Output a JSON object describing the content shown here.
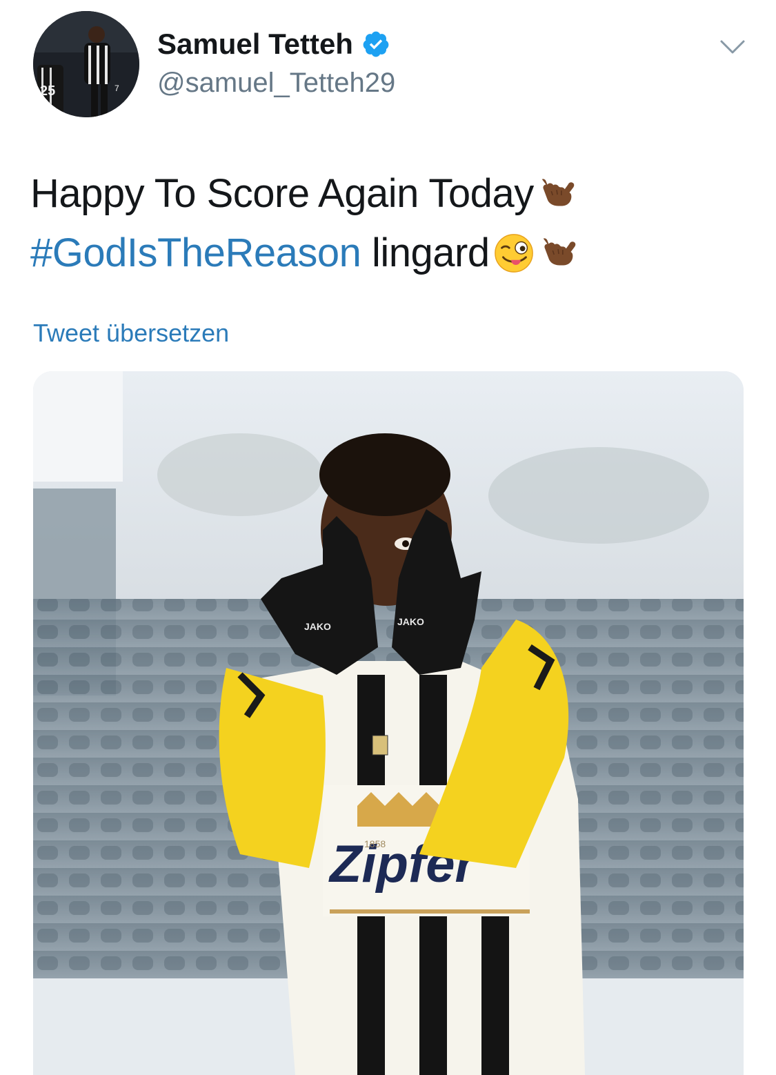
{
  "tweet": {
    "author": {
      "display_name": "Samuel Tetteh",
      "handle": "@samuel_Tetteh29",
      "verified": true,
      "avatar_jersey_numbers": [
        "25",
        "7"
      ]
    },
    "text_line1": "Happy To Score Again Today",
    "hashtag": "#GodIsTheReason",
    "text_line2_rest": " lingard",
    "emojis": [
      "call-me-hand-dark-skin-emoji",
      "winking-face-tongue-emoji"
    ],
    "translate_label": "Tweet übersetzen",
    "media": {
      "glove_brand": "JAKO",
      "sponsor": "Zipfer",
      "sponsor_year": "1858"
    }
  },
  "colors": {
    "link": "#2b7bb9",
    "verified": "#1da1f2",
    "handle": "#657786",
    "text": "#14171a",
    "jersey_yellow": "#f4d21f"
  }
}
